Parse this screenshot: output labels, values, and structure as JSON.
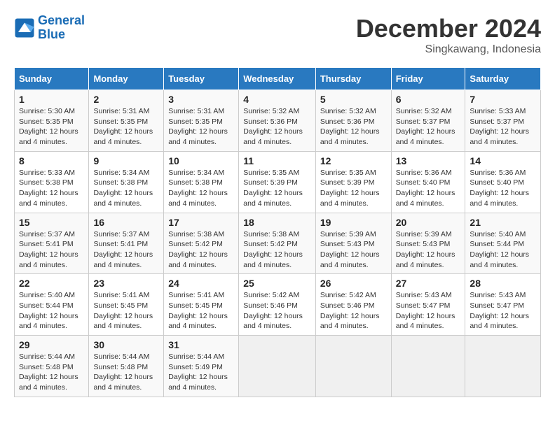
{
  "logo": {
    "line1": "General",
    "line2": "Blue"
  },
  "title": "December 2024",
  "subtitle": "Singkawang, Indonesia",
  "days_header": [
    "Sunday",
    "Monday",
    "Tuesday",
    "Wednesday",
    "Thursday",
    "Friday",
    "Saturday"
  ],
  "weeks": [
    [
      {
        "num": "1",
        "sunrise": "5:30 AM",
        "sunset": "5:35 PM",
        "daylight": "12 hours and 4 minutes."
      },
      {
        "num": "2",
        "sunrise": "5:31 AM",
        "sunset": "5:35 PM",
        "daylight": "12 hours and 4 minutes."
      },
      {
        "num": "3",
        "sunrise": "5:31 AM",
        "sunset": "5:35 PM",
        "daylight": "12 hours and 4 minutes."
      },
      {
        "num": "4",
        "sunrise": "5:32 AM",
        "sunset": "5:36 PM",
        "daylight": "12 hours and 4 minutes."
      },
      {
        "num": "5",
        "sunrise": "5:32 AM",
        "sunset": "5:36 PM",
        "daylight": "12 hours and 4 minutes."
      },
      {
        "num": "6",
        "sunrise": "5:32 AM",
        "sunset": "5:37 PM",
        "daylight": "12 hours and 4 minutes."
      },
      {
        "num": "7",
        "sunrise": "5:33 AM",
        "sunset": "5:37 PM",
        "daylight": "12 hours and 4 minutes."
      }
    ],
    [
      {
        "num": "8",
        "sunrise": "5:33 AM",
        "sunset": "5:38 PM",
        "daylight": "12 hours and 4 minutes."
      },
      {
        "num": "9",
        "sunrise": "5:34 AM",
        "sunset": "5:38 PM",
        "daylight": "12 hours and 4 minutes."
      },
      {
        "num": "10",
        "sunrise": "5:34 AM",
        "sunset": "5:38 PM",
        "daylight": "12 hours and 4 minutes."
      },
      {
        "num": "11",
        "sunrise": "5:35 AM",
        "sunset": "5:39 PM",
        "daylight": "12 hours and 4 minutes."
      },
      {
        "num": "12",
        "sunrise": "5:35 AM",
        "sunset": "5:39 PM",
        "daylight": "12 hours and 4 minutes."
      },
      {
        "num": "13",
        "sunrise": "5:36 AM",
        "sunset": "5:40 PM",
        "daylight": "12 hours and 4 minutes."
      },
      {
        "num": "14",
        "sunrise": "5:36 AM",
        "sunset": "5:40 PM",
        "daylight": "12 hours and 4 minutes."
      }
    ],
    [
      {
        "num": "15",
        "sunrise": "5:37 AM",
        "sunset": "5:41 PM",
        "daylight": "12 hours and 4 minutes."
      },
      {
        "num": "16",
        "sunrise": "5:37 AM",
        "sunset": "5:41 PM",
        "daylight": "12 hours and 4 minutes."
      },
      {
        "num": "17",
        "sunrise": "5:38 AM",
        "sunset": "5:42 PM",
        "daylight": "12 hours and 4 minutes."
      },
      {
        "num": "18",
        "sunrise": "5:38 AM",
        "sunset": "5:42 PM",
        "daylight": "12 hours and 4 minutes."
      },
      {
        "num": "19",
        "sunrise": "5:39 AM",
        "sunset": "5:43 PM",
        "daylight": "12 hours and 4 minutes."
      },
      {
        "num": "20",
        "sunrise": "5:39 AM",
        "sunset": "5:43 PM",
        "daylight": "12 hours and 4 minutes."
      },
      {
        "num": "21",
        "sunrise": "5:40 AM",
        "sunset": "5:44 PM",
        "daylight": "12 hours and 4 minutes."
      }
    ],
    [
      {
        "num": "22",
        "sunrise": "5:40 AM",
        "sunset": "5:44 PM",
        "daylight": "12 hours and 4 minutes."
      },
      {
        "num": "23",
        "sunrise": "5:41 AM",
        "sunset": "5:45 PM",
        "daylight": "12 hours and 4 minutes."
      },
      {
        "num": "24",
        "sunrise": "5:41 AM",
        "sunset": "5:45 PM",
        "daylight": "12 hours and 4 minutes."
      },
      {
        "num": "25",
        "sunrise": "5:42 AM",
        "sunset": "5:46 PM",
        "daylight": "12 hours and 4 minutes."
      },
      {
        "num": "26",
        "sunrise": "5:42 AM",
        "sunset": "5:46 PM",
        "daylight": "12 hours and 4 minutes."
      },
      {
        "num": "27",
        "sunrise": "5:43 AM",
        "sunset": "5:47 PM",
        "daylight": "12 hours and 4 minutes."
      },
      {
        "num": "28",
        "sunrise": "5:43 AM",
        "sunset": "5:47 PM",
        "daylight": "12 hours and 4 minutes."
      }
    ],
    [
      {
        "num": "29",
        "sunrise": "5:44 AM",
        "sunset": "5:48 PM",
        "daylight": "12 hours and 4 minutes."
      },
      {
        "num": "30",
        "sunrise": "5:44 AM",
        "sunset": "5:48 PM",
        "daylight": "12 hours and 4 minutes."
      },
      {
        "num": "31",
        "sunrise": "5:44 AM",
        "sunset": "5:49 PM",
        "daylight": "12 hours and 4 minutes."
      },
      null,
      null,
      null,
      null
    ]
  ]
}
